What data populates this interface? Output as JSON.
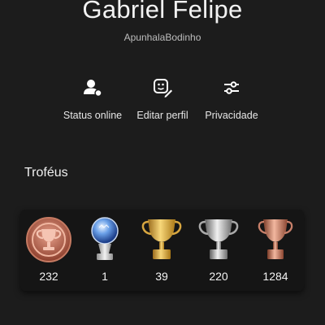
{
  "profile": {
    "name": "Gabriel Felipe",
    "online_id": "ApunhalaBodinho"
  },
  "actions": [
    {
      "label": "Status online",
      "icon": "user-status-icon"
    },
    {
      "label": "Editar perfil",
      "icon": "edit-profile-icon"
    },
    {
      "label": "Privacidade",
      "icon": "privacy-sliders-icon"
    }
  ],
  "trophies": {
    "title": "Troféus",
    "level": {
      "value": "232",
      "icon": "trophy-level-badge-icon"
    },
    "platinum": {
      "value": "1",
      "icon": "platinum-trophy-icon"
    },
    "gold": {
      "value": "39",
      "icon": "gold-trophy-icon"
    },
    "silver": {
      "value": "220",
      "icon": "silver-trophy-icon"
    },
    "bronze": {
      "value": "1284",
      "icon": "bronze-trophy-icon"
    }
  },
  "colors": {
    "background": "#1c1c1c",
    "card": "#151515",
    "gold": "#e0b04a",
    "silver": "#bfbfbf",
    "bronze": "#c8806a",
    "platinum": "#6aa0e8"
  }
}
